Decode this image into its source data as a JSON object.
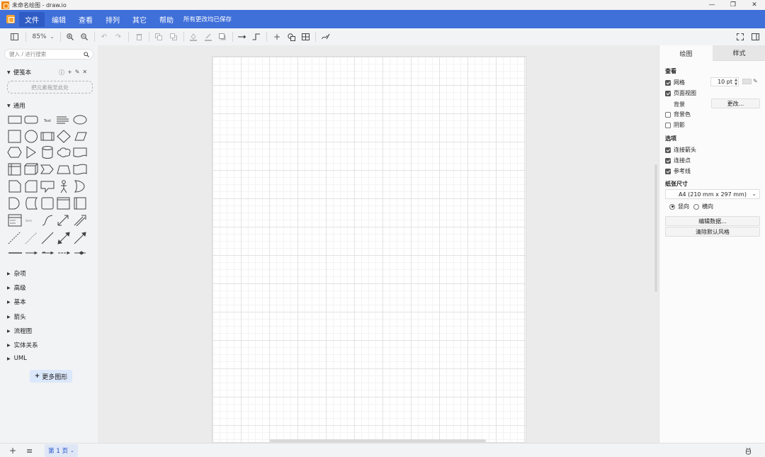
{
  "window": {
    "title": "未命名绘图 - draw.io",
    "minimize_glyph": "—",
    "restore_glyph": "❐",
    "close_glyph": "✕"
  },
  "menu": {
    "items": [
      "文件",
      "编辑",
      "查看",
      "排列",
      "其它",
      "帮助"
    ],
    "status": "所有更改均已保存",
    "accent": "#3f6fd9"
  },
  "toolbar": {
    "zoom": "85%"
  },
  "left": {
    "search_placeholder": "键入 / 进行搜索",
    "scratchpad": "便笺本",
    "dropzone": "把元素拖至此处",
    "general": "通用",
    "categories": [
      "杂项",
      "高级",
      "基本",
      "箭头",
      "流程图",
      "实体关系",
      "UML"
    ],
    "more_shapes": "更多图形",
    "shape_text_label": "Text"
  },
  "right": {
    "tabs": [
      "绘图",
      "样式"
    ],
    "view_section": "查看",
    "grid": "网格",
    "grid_size": "10 pt",
    "page_view": "页面视图",
    "background": "背景",
    "change_button": "更改...",
    "background_color": "背景色",
    "shadow": "阴影",
    "options_section": "选项",
    "connection_arrows": "连接箭头",
    "connection_points": "连接点",
    "guides": "参考线",
    "paper_section": "纸张尺寸",
    "paper_size": "A4 (210 mm x 297 mm)",
    "portrait": "竖向",
    "landscape": "横向",
    "edit_data": "编辑数据...",
    "clear_style": "清除默认风格"
  },
  "footer": {
    "page_tab": "第 1 页"
  }
}
